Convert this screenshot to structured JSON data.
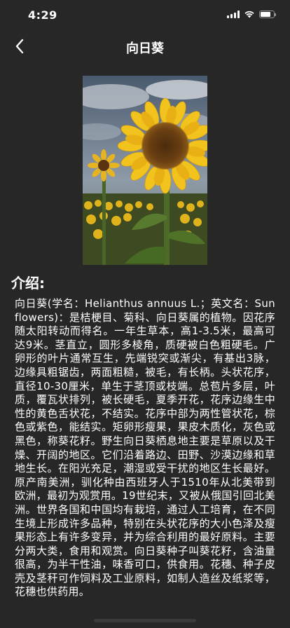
{
  "status_bar": {
    "time": "4:29",
    "icons": [
      "cellular-signal-icon",
      "wifi-icon",
      "battery-icon"
    ],
    "battery_level": 0.8
  },
  "nav": {
    "back_icon": "chevron-left-icon",
    "title": "向日葵"
  },
  "image": {
    "subject": "sunflower-photo"
  },
  "section": {
    "heading": "介绍:"
  },
  "article": {
    "body": "向日葵(学名：Helianthus annuus L.；英文名：Sunflowers)：是桔梗目、菊科、向日葵属的植物。因花序随太阳转动而得名。一年生草本，高1-3.5米，最高可达9米。茎直立，圆形多棱角，质硬被白色粗硬毛。广卵形的叶片通常互生，先端锐突或渐尖，有基出3脉，边缘具粗锯齿，两面粗糙，被毛，有长柄。头状花序，直径10-30厘米，单生于茎顶或枝端。总苞片多层，叶质，覆瓦状排列，被长硬毛，夏季开花，花序边缘生中性的黄色舌状花，不结实。花序中部为两性管状花，棕色或紫色，能结实。矩卵形瘦果，果皮木质化，灰色或黑色，称葵花籽。野生向日葵栖息地主要是草原以及干燥、开阔的地区。它们沿着路边、田野、沙漠边缘和草地生长。在阳光充足，潮湿或受干扰的地区生长最好。原产南美洲，驯化种由西班牙人于1510年从北美带到欧洲，最初为观赏用。19世纪末，又被从俄国引回北美洲。世界各国和中国均有栽培，通过人工培育，在不同生境上形成许多品种，特别在头状花序的大小色泽及瘦果形态上有许多变异，并为综合利用的最好原料。主要分两大类，食用和观赏。向日葵种子叫葵花籽，含油量很高，为半干性油，味香可口，供食用。花穗、种子皮壳及茎秆可作饲料及工业原料，如制人造丝及纸浆等，花穗也供药用。"
  }
}
